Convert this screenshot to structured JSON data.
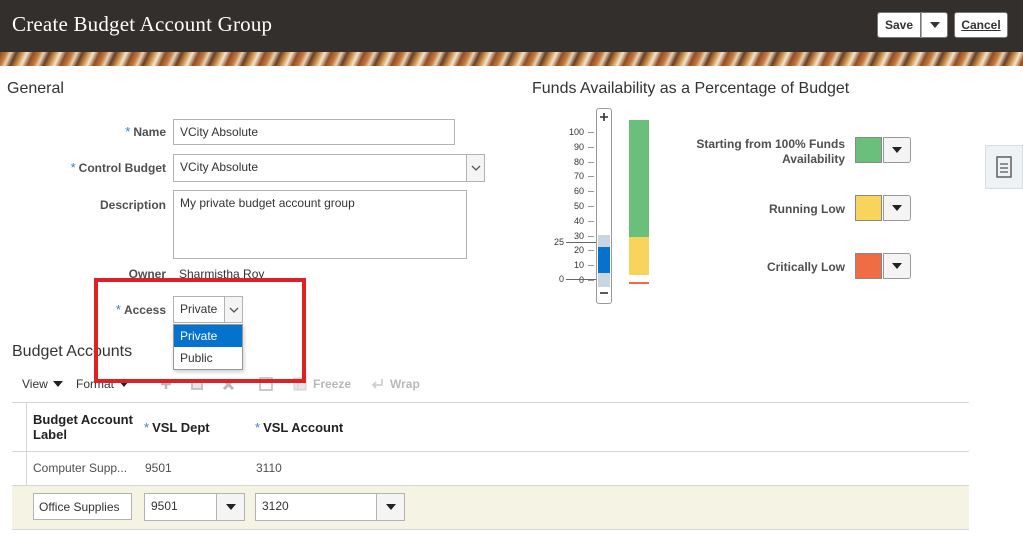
{
  "header": {
    "title": "Create Budget Account Group",
    "save_label": "Save",
    "cancel_label": "Cancel"
  },
  "general": {
    "section_title": "General",
    "name": {
      "label": "Name",
      "value": "VCity Absolute"
    },
    "control_budget": {
      "label": "Control Budget",
      "value": "VCity Absolute"
    },
    "description": {
      "label": "Description",
      "value": "My private budget account group"
    },
    "owner": {
      "label": "Owner",
      "value": "Sharmistha Roy"
    },
    "access": {
      "label": "Access",
      "value": "Private",
      "options": [
        "Private",
        "Public"
      ],
      "selected_option": "Private"
    }
  },
  "funds": {
    "section_title": "Funds Availability as a Percentage of Budget",
    "slider_ticks": [
      "100",
      "90",
      "80",
      "70",
      "60",
      "50",
      "40",
      "30",
      "20",
      "10",
      "0"
    ],
    "slider_value_label": "25",
    "slider_zero_label": "0",
    "thresholds": [
      {
        "label": "Starting from 100% Funds Availability",
        "color": "#6abf7b"
      },
      {
        "label": "Running Low",
        "color": "#f9d45c"
      },
      {
        "label": "Critically Low",
        "color": "#f06c45"
      }
    ],
    "bar_colors": {
      "green": "#6abf7b",
      "yellow": "#f9d45c",
      "red": "#f06c45"
    }
  },
  "budget_accounts": {
    "section_title": "Budget Accounts",
    "toolbar": {
      "view": "View",
      "format": "Format",
      "freeze": "Freeze",
      "wrap": "Wrap"
    },
    "columns": [
      "Budget Account Label",
      "VSL Dept",
      "VSL Account"
    ],
    "rows": [
      {
        "label": "Computer Supp...",
        "dept": "9501",
        "account": "3110"
      },
      {
        "label": "Office Supplies",
        "dept": "9501",
        "account": "3120"
      }
    ]
  }
}
